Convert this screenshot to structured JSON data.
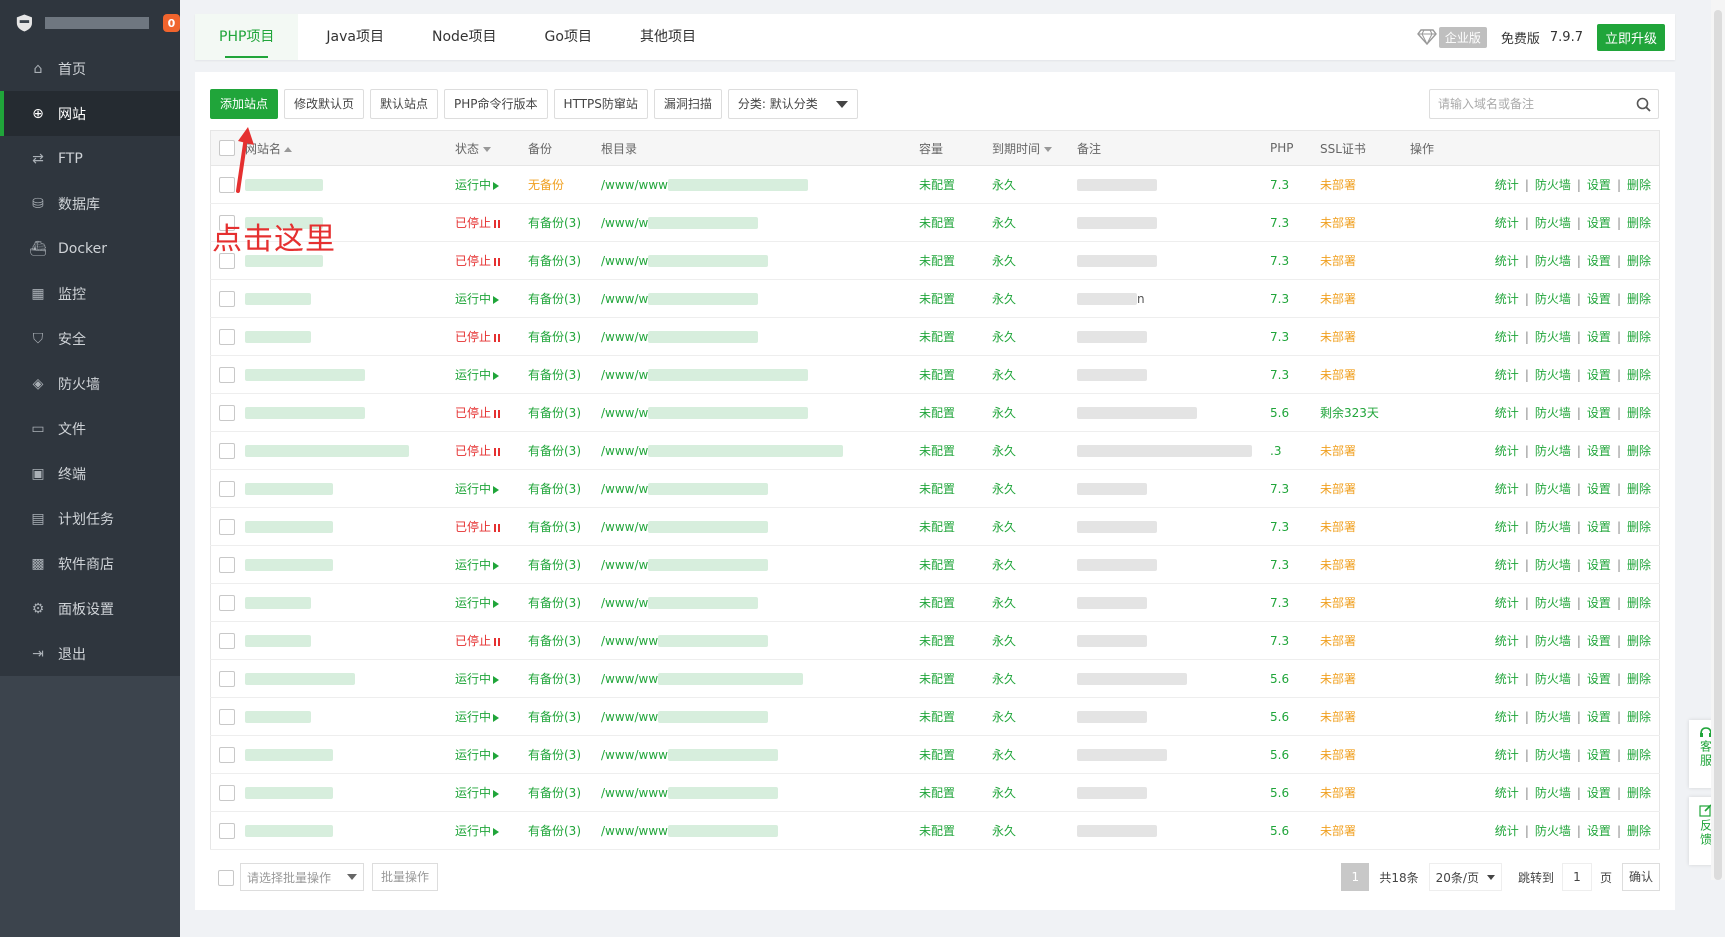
{
  "sidebar": {
    "badge": "0",
    "items": [
      {
        "label": "首页",
        "icon": "home-icon"
      },
      {
        "label": "网站",
        "icon": "globe-icon",
        "active": true
      },
      {
        "label": "FTP",
        "icon": "ftp-icon"
      },
      {
        "label": "数据库",
        "icon": "database-icon"
      },
      {
        "label": "Docker",
        "icon": "docker-icon"
      },
      {
        "label": "监控",
        "icon": "monitor-icon"
      },
      {
        "label": "安全",
        "icon": "shield-icon"
      },
      {
        "label": "防火墙",
        "icon": "firewall-icon"
      },
      {
        "label": "文件",
        "icon": "folder-icon"
      },
      {
        "label": "终端",
        "icon": "terminal-icon"
      },
      {
        "label": "计划任务",
        "icon": "calendar-icon"
      },
      {
        "label": "软件商店",
        "icon": "grid-icon"
      },
      {
        "label": "面板设置",
        "icon": "gear-icon"
      },
      {
        "label": "退出",
        "icon": "logout-icon"
      }
    ]
  },
  "tabs": [
    "PHP项目",
    "Java项目",
    "Node项目",
    "Go项目",
    "其他项目"
  ],
  "version": {
    "edition": "企业版",
    "free": "免费版",
    "number": "7.9.7",
    "upgrade": "立即升级"
  },
  "toolbar": {
    "add_site": "添加站点",
    "modify_default_page": "修改默认页",
    "default_site": "默认站点",
    "php_cli": "PHP命令行版本",
    "https_guard": "HTTPS防窜站",
    "vuln_scan": "漏洞扫描",
    "category": "分类: 默认分类"
  },
  "search": {
    "placeholder": "请输入域名或备注"
  },
  "annotation": "点击这里",
  "table": {
    "headers": {
      "name": "网站名",
      "status": "状态",
      "backup": "备份",
      "root": "根目录",
      "capacity": "容量",
      "expire": "到期时间",
      "note": "备注",
      "php": "PHP",
      "ssl": "SSL证书",
      "ops": "操作"
    },
    "rows": [
      {
        "status": "运行中",
        "running": true,
        "backup": "无备份",
        "has_backup": false,
        "root": "/www/www",
        "capacity": "未配置",
        "expire": "永久",
        "note": "",
        "php": "7.3",
        "ssl": "未部署"
      },
      {
        "status": "已停止",
        "running": false,
        "backup": "有备份(3)",
        "has_backup": true,
        "root": "/www/w",
        "capacity": "未配置",
        "expire": "永久",
        "note": "",
        "php": "7.3",
        "ssl": "未部署"
      },
      {
        "status": "已停止",
        "running": false,
        "backup": "有备份(3)",
        "has_backup": true,
        "root": "/www/w",
        "capacity": "未配置",
        "expire": "永久",
        "note": "",
        "php": "7.3",
        "ssl": "未部署"
      },
      {
        "status": "运行中",
        "running": true,
        "backup": "有备份(3)",
        "has_backup": true,
        "root": "/www/w",
        "capacity": "未配置",
        "expire": "永久",
        "note": "n",
        "php": "7.3",
        "ssl": "未部署"
      },
      {
        "status": "已停止",
        "running": false,
        "backup": "有备份(3)",
        "has_backup": true,
        "root": "/www/w",
        "capacity": "未配置",
        "expire": "永久",
        "note": "",
        "php": "7.3",
        "ssl": "未部署"
      },
      {
        "status": "运行中",
        "running": true,
        "backup": "有备份(3)",
        "has_backup": true,
        "root": "/www/w",
        "capacity": "未配置",
        "expire": "永久",
        "note": "",
        "php": "7.3",
        "ssl": "未部署"
      },
      {
        "status": "已停止",
        "running": false,
        "backup": "有备份(3)",
        "has_backup": true,
        "root": "/www/w",
        "capacity": "未配置",
        "expire": "永久",
        "note": "",
        "php": "5.6",
        "ssl": "剩余323天",
        "ssl_ok": true
      },
      {
        "status": "已停止",
        "running": false,
        "backup": "有备份(3)",
        "has_backup": true,
        "root": "/www/w",
        "capacity": "未配置",
        "expire": "永久",
        "note": "",
        "php": ".3",
        "ssl": "未部署"
      },
      {
        "status": "运行中",
        "running": true,
        "backup": "有备份(3)",
        "has_backup": true,
        "root": "/www/w",
        "capacity": "未配置",
        "expire": "永久",
        "note": "",
        "php": "7.3",
        "ssl": "未部署"
      },
      {
        "status": "已停止",
        "running": false,
        "backup": "有备份(3)",
        "has_backup": true,
        "root": "/www/w",
        "capacity": "未配置",
        "expire": "永久",
        "note": "",
        "php": "7.3",
        "ssl": "未部署"
      },
      {
        "status": "运行中",
        "running": true,
        "backup": "有备份(3)",
        "has_backup": true,
        "root": "/www/w",
        "capacity": "未配置",
        "expire": "永久",
        "note": "",
        "php": "7.3",
        "ssl": "未部署"
      },
      {
        "status": "运行中",
        "running": true,
        "backup": "有备份(3)",
        "has_backup": true,
        "root": "/www/w",
        "capacity": "未配置",
        "expire": "永久",
        "note": "",
        "php": "7.3",
        "ssl": "未部署"
      },
      {
        "status": "已停止",
        "running": false,
        "backup": "有备份(3)",
        "has_backup": true,
        "root": "/www/ww",
        "capacity": "未配置",
        "expire": "永久",
        "note": "",
        "php": "7.3",
        "ssl": "未部署"
      },
      {
        "status": "运行中",
        "running": true,
        "backup": "有备份(3)",
        "has_backup": true,
        "root": "/www/ww",
        "capacity": "未配置",
        "expire": "永久",
        "note": "",
        "php": "5.6",
        "ssl": "未部署"
      },
      {
        "status": "运行中",
        "running": true,
        "backup": "有备份(3)",
        "has_backup": true,
        "root": "/www/ww",
        "capacity": "未配置",
        "expire": "永久",
        "note": "",
        "php": "5.6",
        "ssl": "未部署"
      },
      {
        "status": "运行中",
        "running": true,
        "backup": "有备份(3)",
        "has_backup": true,
        "root": "/www/www",
        "capacity": "未配置",
        "expire": "永久",
        "note": "",
        "php": "5.6",
        "ssl": "未部署"
      },
      {
        "status": "运行中",
        "running": true,
        "backup": "有备份(3)",
        "has_backup": true,
        "root": "/www/www",
        "capacity": "未配置",
        "expire": "永久",
        "note": "",
        "php": "5.6",
        "ssl": "未部署"
      },
      {
        "status": "运行中",
        "running": true,
        "backup": "有备份(3)",
        "has_backup": true,
        "root": "/www/www",
        "capacity": "未配置",
        "expire": "永久",
        "note": "",
        "php": "5.6",
        "ssl": "未部署"
      }
    ],
    "ops": [
      "统计",
      "防火墙",
      "设置",
      "删除"
    ]
  },
  "footer": {
    "batch_placeholder": "请选择批量操作",
    "batch_button": "批量操作",
    "page": "1",
    "total": "共18条",
    "page_size": "20条/页",
    "jump_label": "跳转到",
    "jump_value": "1",
    "page_unit": "页",
    "confirm": "确认"
  },
  "float": {
    "service": "客服",
    "feedback": "反馈"
  },
  "colors": {
    "accent": "#20a53a",
    "danger": "#e53030",
    "warning": "#f0a020",
    "sidebar": "#3c444d"
  }
}
